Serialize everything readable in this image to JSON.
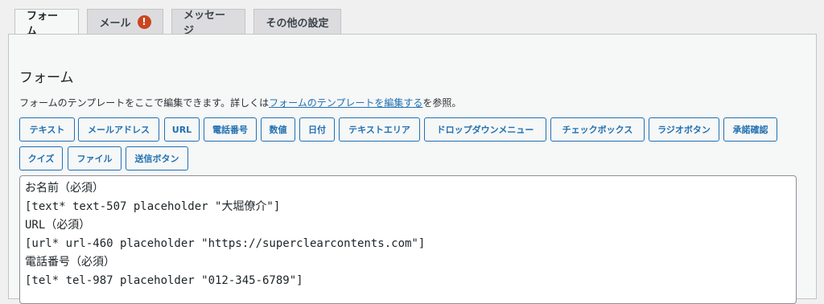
{
  "tabs": [
    {
      "label": "フォーム",
      "active": true
    },
    {
      "label": "メール",
      "badge": "!"
    },
    {
      "label": "メッセージ"
    },
    {
      "label": "その他の設定"
    }
  ],
  "panel": {
    "title": "フォーム",
    "description_prefix": "フォームのテンプレートをここで編集できます。詳しくは",
    "description_link": "フォームのテンプレートを編集する",
    "description_suffix": "を参照。"
  },
  "tag_buttons": [
    "テキスト",
    "メールアドレス",
    "URL",
    "電話番号",
    "数値",
    "日付",
    "テキストエリア",
    "ドロップダウンメニュー",
    "チェックボックス",
    "ラジオボタン",
    "承諾確認",
    "クイズ",
    "ファイル",
    "送信ボタン"
  ],
  "editor": {
    "lines": [
      "お名前（必須）",
      "[text* text-507 placeholder \"大堀僚介\"]",
      "URL（必須）",
      "[url* url-460 placeholder \"https://superclearcontents.com\"]",
      "電話番号（必須）",
      "[tel* tel-987 placeholder \"012-345-6789\"]"
    ]
  },
  "colors": {
    "accent": "#2271b1",
    "badge": "#c9461f",
    "background": "#f0f0f1"
  }
}
